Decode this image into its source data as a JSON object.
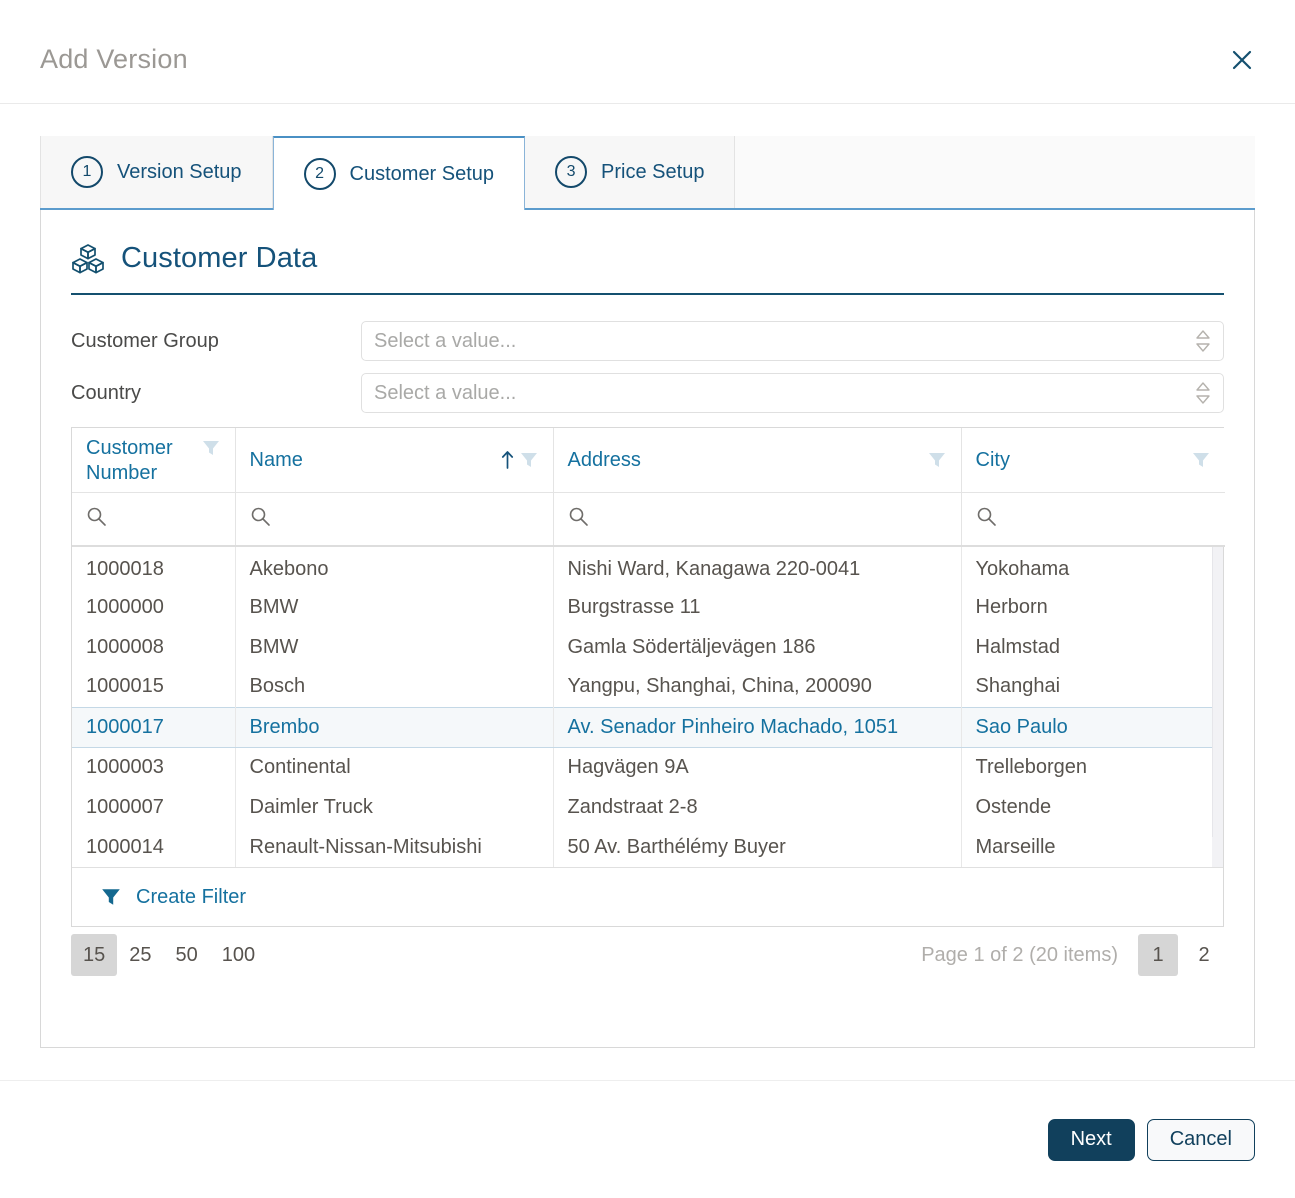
{
  "dialog": {
    "title": "Add Version",
    "close_icon": "close-icon"
  },
  "tabs": [
    {
      "num": "1",
      "label": "Version Setup",
      "active": false
    },
    {
      "num": "2",
      "label": "Customer Setup",
      "active": true
    },
    {
      "num": "3",
      "label": "Price Setup",
      "active": false
    }
  ],
  "section": {
    "icon": "cubes-icon",
    "title": "Customer Data"
  },
  "form": {
    "customer_group": {
      "label": "Customer Group",
      "value": "",
      "placeholder": "Select a value..."
    },
    "country": {
      "label": "Country",
      "value": "",
      "placeholder": "Select a value..."
    }
  },
  "table": {
    "columns": [
      {
        "label": "Customer Number",
        "sorted": false,
        "filter_icon": "filter-icon"
      },
      {
        "label": "Name",
        "sorted": true,
        "sort_direction": "asc",
        "sort_icon": "arrow-up-icon",
        "filter_icon": "filter-icon"
      },
      {
        "label": "Address",
        "sorted": false,
        "filter_icon": "filter-icon"
      },
      {
        "label": "City",
        "sorted": false,
        "filter_icon": "filter-icon"
      }
    ],
    "search_row": {
      "icon": "search-icon",
      "values": [
        "",
        "",
        "",
        ""
      ]
    },
    "rows": [
      {
        "customer_number": "1000018",
        "name": "Akebono",
        "address": "Nishi Ward, Kanagawa 220-0041",
        "city": "Yokohama",
        "selected": false
      },
      {
        "customer_number": "1000000",
        "name": "BMW",
        "address": "Burgstrasse 11",
        "city": "Herborn",
        "selected": false
      },
      {
        "customer_number": "1000008",
        "name": "BMW",
        "address": "Gamla Södertäljevägen 186",
        "city": "Halmstad",
        "selected": false
      },
      {
        "customer_number": "1000015",
        "name": "Bosch",
        "address": "Yangpu, Shanghai, China, 200090",
        "city": "Shanghai",
        "selected": false
      },
      {
        "customer_number": "1000017",
        "name": "Brembo",
        "address": "Av. Senador Pinheiro Machado, 1051",
        "city": "Sao Paulo",
        "selected": true
      },
      {
        "customer_number": "1000003",
        "name": "Continental",
        "address": "Hagvägen 9A",
        "city": "Trelleborgen",
        "selected": false
      },
      {
        "customer_number": "1000007",
        "name": "Daimler Truck",
        "address": "Zandstraat 2-8",
        "city": "Ostende",
        "selected": false
      },
      {
        "customer_number": "1000014",
        "name": "Renault-Nissan-Mitsubishi",
        "address": "50 Av. Barthélémy Buyer",
        "city": "Marseille",
        "selected": false
      }
    ],
    "create_filter": {
      "icon": "filter-icon",
      "label": "Create Filter"
    }
  },
  "pagination": {
    "page_sizes": [
      "15",
      "25",
      "50",
      "100"
    ],
    "active_page_size": "15",
    "status": "Page 1 of 2 (20 items)",
    "pages": [
      "1",
      "2"
    ],
    "active_page": "1"
  },
  "footer": {
    "next_label": "Next",
    "cancel_label": "Cancel"
  },
  "colors": {
    "accent_blue": "#15719f",
    "dark_navy": "#11405c",
    "title_gray": "#9b9894",
    "filter_icon": "#cfdfe9",
    "selected_row_bg": "#f5f8fa"
  }
}
